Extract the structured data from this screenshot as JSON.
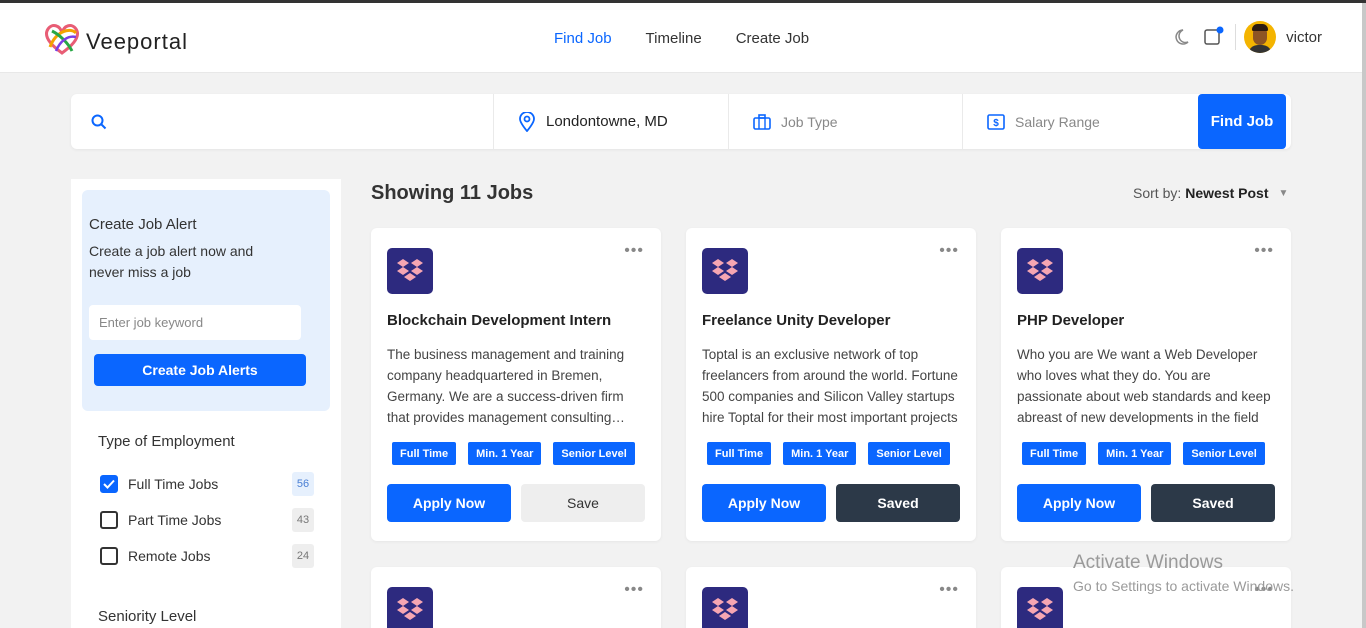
{
  "header": {
    "logo_text": "Veeportal",
    "nav": [
      "Find Job",
      "Timeline",
      "Create Job"
    ],
    "active_nav": "Find Job",
    "username": "victor"
  },
  "search": {
    "keyword_value": "",
    "location": "Londontowne, MD",
    "job_type_placeholder": "Job Type",
    "salary_placeholder": "Salary Range",
    "find_button": "Find Job"
  },
  "sidebar": {
    "alert_title": "Create Job Alert",
    "alert_desc": "Create a job alert now and never miss a job",
    "alert_input_placeholder": "Enter job keyword",
    "alert_button": "Create Job Alerts",
    "employment_title": "Type of Employment",
    "employment": [
      {
        "label": "Full Time Jobs",
        "count": "56",
        "checked": true
      },
      {
        "label": "Part Time Jobs",
        "count": "43",
        "checked": false
      },
      {
        "label": "Remote Jobs",
        "count": "24",
        "checked": false
      }
    ],
    "seniority_title": "Seniority Level"
  },
  "main": {
    "showing": "Showing 11 Jobs",
    "sort_label": "Sort by:",
    "sort_value": "Newest Post"
  },
  "jobs": [
    {
      "title": "Blockchain Development Intern",
      "desc": "The business management and training company headquartered in Bremen, Germany. We are a success-driven firm that provides management consulting services",
      "tags": [
        "Full Time",
        "Min. 1 Year",
        "Senior Level"
      ],
      "apply": "Apply Now",
      "save": "Save",
      "saved": false
    },
    {
      "title": "Freelance Unity Developer",
      "desc": "Toptal is an exclusive network of top freelancers from around the world. Fortune 500 companies and Silicon Valley startups hire Toptal for their most important projects",
      "tags": [
        "Full Time",
        "Min. 1 Year",
        "Senior Level"
      ],
      "apply": "Apply Now",
      "save": "Saved",
      "saved": true
    },
    {
      "title": "PHP Developer",
      "desc": "Who you are We want a Web Developer who loves what they do. You are passionate about web standards and keep abreast of new developments in the field",
      "tags": [
        "Full Time",
        "Min. 1 Year",
        "Senior Level"
      ],
      "apply": "Apply Now",
      "save": "Saved",
      "saved": true
    }
  ],
  "watermark": {
    "line1": "Activate Windows",
    "line2": "Go to Settings to activate Windows."
  },
  "colors": {
    "accent": "#0a66ff",
    "saved_button": "#2c3948",
    "company_logo_bg": "#2d2a7f",
    "company_logo_fg": "#f6a6b2"
  }
}
